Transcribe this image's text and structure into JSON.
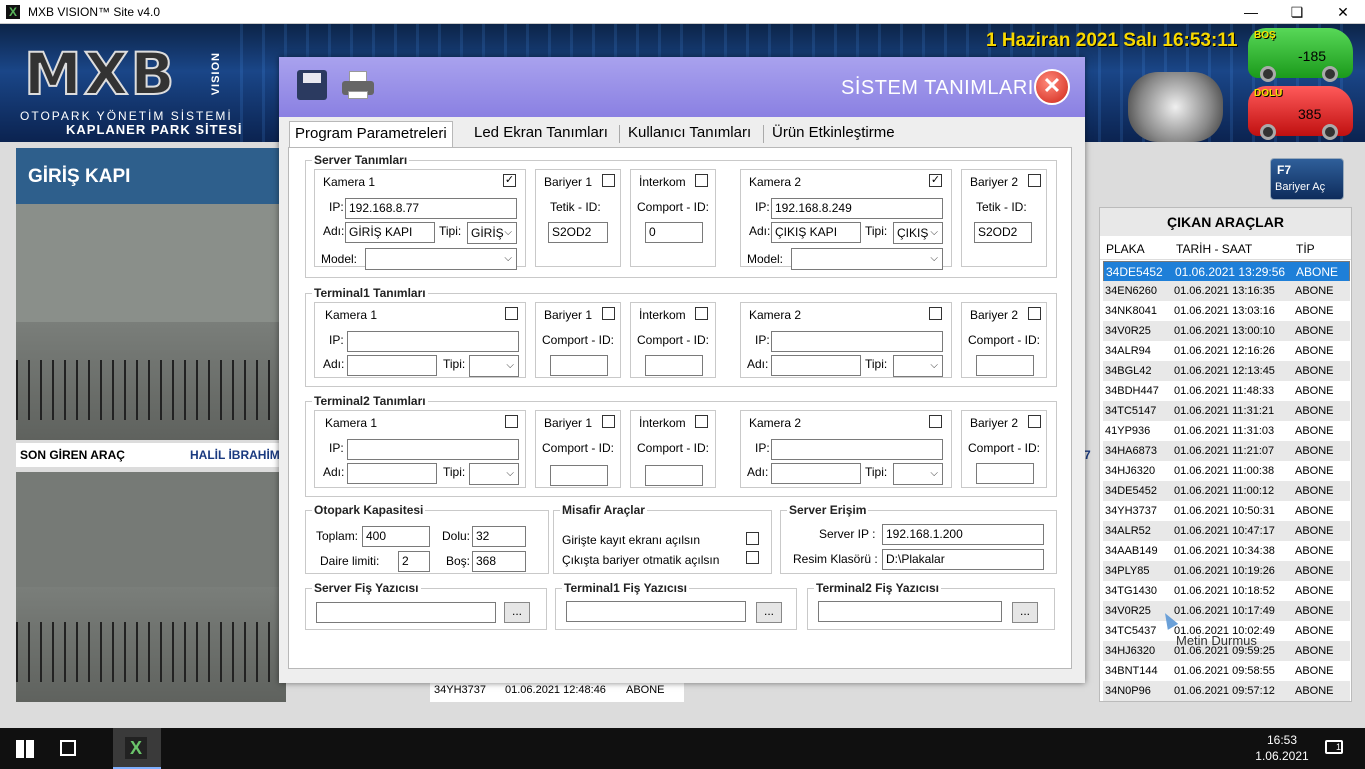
{
  "window": {
    "title": "MXB VISION™ Site v4.0",
    "minimize": "—",
    "maximize": "❏",
    "close": "✕"
  },
  "header": {
    "logo": "MXB",
    "logo_vision": "VISION",
    "subtitle1": "OTOPARK YÖNETİM SİSTEMİ",
    "subtitle2": "KAPLANER PARK SİTESİ",
    "datetime": "1 Haziran 2021 Salı 16:53:11",
    "bos_label": "BOŞ",
    "bos_value": "-185",
    "dolu_label": "DOLU",
    "dolu_value": "385"
  },
  "left": {
    "gate_title": "GİRİŞ KAPI",
    "last_in_label": "SON GİREN ARAÇ",
    "last_in_name": "HALİL İBRAHİM",
    "side_digit": "7"
  },
  "f7": {
    "key": "F7",
    "label": "Bariyer Aç"
  },
  "cikan": {
    "title": "ÇIKAN ARAÇLAR",
    "col_plaka": "PLAKA",
    "col_tarih": "TARİH - SAAT",
    "col_tip": "TİP",
    "rows": [
      {
        "plaka": "34DE5452",
        "tarih": "01.06.2021 13:29:56",
        "tip": "ABONE"
      },
      {
        "plaka": "34EN6260",
        "tarih": "01.06.2021 13:16:35",
        "tip": "ABONE"
      },
      {
        "plaka": "34NK8041",
        "tarih": "01.06.2021 13:03:16",
        "tip": "ABONE"
      },
      {
        "plaka": "34V0R25",
        "tarih": "01.06.2021 13:00:10",
        "tip": "ABONE"
      },
      {
        "plaka": "34ALR94",
        "tarih": "01.06.2021 12:16:26",
        "tip": "ABONE"
      },
      {
        "plaka": "34BGL42",
        "tarih": "01.06.2021 12:13:45",
        "tip": "ABONE"
      },
      {
        "plaka": "34BDH447",
        "tarih": "01.06.2021 11:48:33",
        "tip": "ABONE"
      },
      {
        "plaka": "34TC5147",
        "tarih": "01.06.2021 11:31:21",
        "tip": "ABONE"
      },
      {
        "plaka": "41YP936",
        "tarih": "01.06.2021 11:31:03",
        "tip": "ABONE"
      },
      {
        "plaka": "34HA6873",
        "tarih": "01.06.2021 11:21:07",
        "tip": "ABONE"
      },
      {
        "plaka": "34HJ6320",
        "tarih": "01.06.2021 11:00:38",
        "tip": "ABONE"
      },
      {
        "plaka": "34DE5452",
        "tarih": "01.06.2021 11:00:12",
        "tip": "ABONE"
      },
      {
        "plaka": "34YH3737",
        "tarih": "01.06.2021 10:50:31",
        "tip": "ABONE"
      },
      {
        "plaka": "34ALR52",
        "tarih": "01.06.2021 10:47:17",
        "tip": "ABONE"
      },
      {
        "plaka": "34AAB149",
        "tarih": "01.06.2021 10:34:38",
        "tip": "ABONE"
      },
      {
        "plaka": "34PLY85",
        "tarih": "01.06.2021 10:19:26",
        "tip": "ABONE"
      },
      {
        "plaka": "34TG1430",
        "tarih": "01.06.2021 10:18:52",
        "tip": "ABONE"
      },
      {
        "plaka": "34V0R25",
        "tarih": "01.06.2021 10:17:49",
        "tip": "ABONE"
      },
      {
        "plaka": "34TC5437",
        "tarih": "01.06.2021 10:02:49",
        "tip": "ABONE"
      },
      {
        "plaka": "34HJ6320",
        "tarih": "01.06.2021 09:59:25",
        "tip": "ABONE"
      },
      {
        "plaka": "34BNT144",
        "tarih": "01.06.2021 09:58:55",
        "tip": "ABONE"
      },
      {
        "plaka": "34N0P96",
        "tarih": "01.06.2021 09:57:12",
        "tip": "ABONE"
      }
    ]
  },
  "bottom_row": {
    "plaka": "34YH3737",
    "tarih": "01.06.2021 12:48:46",
    "tip": "ABONE"
  },
  "watermark": "Metin Durmus",
  "taskbar": {
    "time": "16:53",
    "date": "1.06.2021",
    "notif": "1"
  },
  "dialog": {
    "title": "SİSTEM TANIMLARI",
    "close": "✕",
    "tabs": [
      "Program Parametreleri",
      "Led Ekran Tanımları",
      "Kullanıcı Tanımları",
      "Ürün Etkinleştirme"
    ],
    "server": {
      "title": "Server Tanımları",
      "kamera1": "Kamera 1",
      "kamera1_checked": "✓",
      "ip_label": "IP:",
      "ip1": "192.168.8.77",
      "adi_label": "Adı:",
      "adi1": "GİRİŞ KAPI",
      "tipi_label": "Tipi:",
      "tipi1": "GİRİŞ",
      "model_label": "Model:",
      "bariyer1": "Bariyer 1",
      "tetik_label": "Tetik - ID:",
      "tetik1": "S2OD2",
      "interkom": "İnterkom",
      "comport_label": "Comport - ID:",
      "comport_value": "0",
      "kamera2": "Kamera 2",
      "kamera2_checked": "✓",
      "ip2": "192.168.8.249",
      "adi2": "ÇIKIŞ KAPI",
      "tipi2": "ÇIKIŞ",
      "bariyer2": "Bariyer  2",
      "tetik2": "S2OD2"
    },
    "terminal1": {
      "title": "Terminal1 Tanımları"
    },
    "terminal2": {
      "title": "Terminal2 Tanımları"
    },
    "labels": {
      "kamera1": "Kamera 1",
      "kamera2": "Kamera 2",
      "bariyer1": "Bariyer 1",
      "bariyer2": "Bariyer 2",
      "interkom": "İnterkom",
      "comport": "Comport - ID:",
      "ip": "IP:",
      "adi": "Adı:",
      "tipi": "Tipi:"
    },
    "kapasite": {
      "title": "Otopark Kapasitesi",
      "toplam_label": "Toplam:",
      "toplam": "400",
      "dolu_label": "Dolu:",
      "dolu": "32",
      "daire_label": "Daire limiti:",
      "daire": "2",
      "bos_label": "Boş:",
      "bos": "368"
    },
    "misafir": {
      "title": "Misafir Araçlar",
      "opt1": "Girişte kayıt ekranı açılsın",
      "opt2": "Çıkışta bariyer otmatik açılsın"
    },
    "erisim": {
      "title": "Server Erişim",
      "ip_label": "Server IP :",
      "ip": "192.168.1.200",
      "klasor_label": "Resim Klasörü :",
      "klasor": "D:\\Plakalar"
    },
    "yazici": {
      "server": "Server Fiş Yazıcısı",
      "t1": "Terminal1 Fiş Yazıcısı",
      "t2": "Terminal2 Fiş Yazıcısı",
      "btn": "..."
    }
  }
}
